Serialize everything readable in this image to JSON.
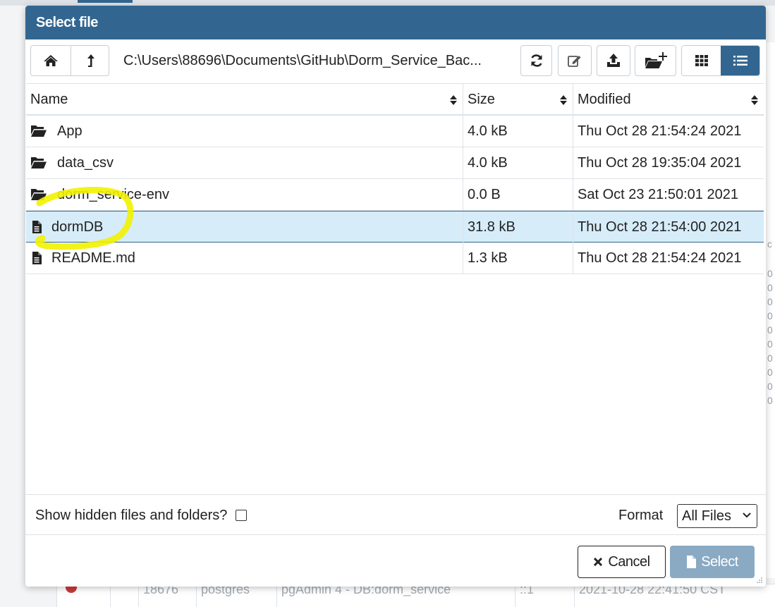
{
  "background": {
    "right_panel_chars": [
      "c",
      "0",
      "0",
      "0",
      "0",
      "0",
      "0",
      "0",
      "0",
      "0",
      "0"
    ],
    "bottom_row": {
      "cells": [
        "18676",
        "postgres",
        "pgAdmin 4 - DB:dorm_service",
        "::1",
        "2021-10-28 22:41:50 CST"
      ]
    }
  },
  "dialog": {
    "title": "Select file",
    "toolbar": {
      "home_icon": "home-icon",
      "up_icon": "level-up-icon",
      "path": "C:\\Users\\88696\\Documents\\GitHub\\Dorm_Service_Bac...",
      "refresh_icon": "refresh-icon",
      "rename_icon": "edit-icon",
      "upload_icon": "upload-icon",
      "new_folder_icon": "folder-plus-icon",
      "grid_view_icon": "grid-view-icon",
      "list_view_icon": "list-view-icon",
      "active_view": "list"
    },
    "table": {
      "columns": [
        "Name",
        "Size",
        "Modified"
      ],
      "rows": [
        {
          "type": "folder",
          "name": "App",
          "size": "4.0 kB",
          "modified": "Thu Oct 28 21:54:24 2021"
        },
        {
          "type": "folder",
          "name": "data_csv",
          "size": "4.0 kB",
          "modified": "Thu Oct 28 19:35:04 2021"
        },
        {
          "type": "folder",
          "name": "dorm_service-env",
          "size": "0.0 B",
          "modified": "Sat Oct 23 21:50:01 2021"
        },
        {
          "type": "file",
          "name": "dormDB",
          "size": "31.8 kB",
          "modified": "Thu Oct 28 21:54:00 2021",
          "selected": true
        },
        {
          "type": "file",
          "name": "README.md",
          "size": "1.3 kB",
          "modified": "Thu Oct 28 21:54:24 2021"
        }
      ]
    },
    "footer": {
      "show_hidden_label": "Show hidden files and folders?",
      "show_hidden_checked": false,
      "format_label": "Format",
      "format_value": "All Files",
      "cancel_label": "Cancel",
      "select_label": "Select"
    },
    "colors": {
      "header": "#326690",
      "selected_row": "#d6ecf9",
      "select_button_disabled": "#8aa9c3",
      "highlighter": "#f2f200"
    }
  }
}
